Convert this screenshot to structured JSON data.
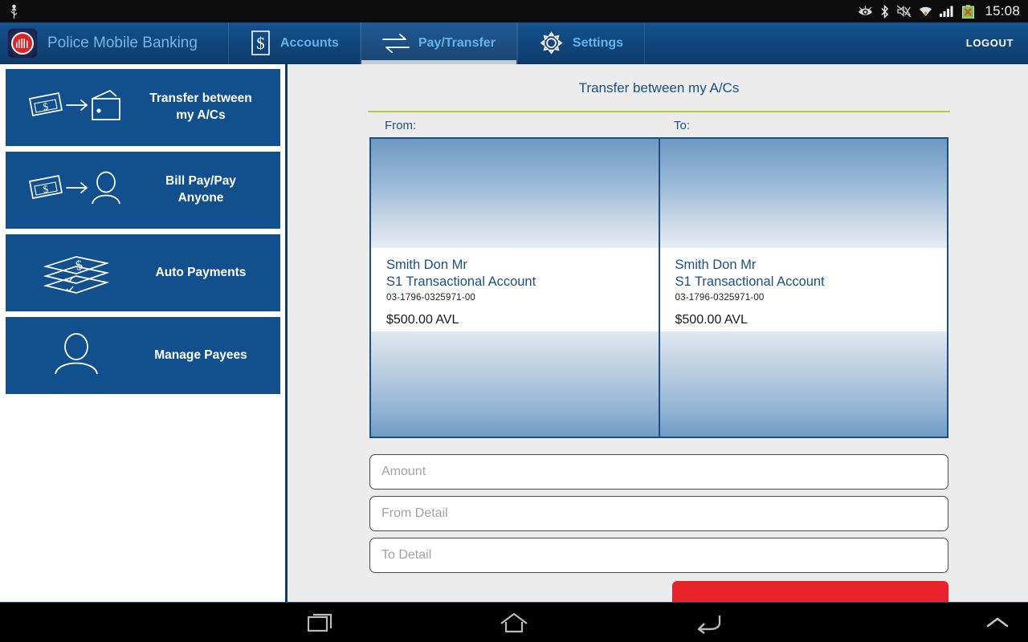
{
  "statusbar": {
    "time": "15:08",
    "icons": [
      "usb-icon",
      "eye-icon",
      "bluetooth-icon",
      "mute-icon",
      "wifi-icon",
      "signal-icon",
      "battery-icon"
    ]
  },
  "header": {
    "app_title": "Police Mobile Banking",
    "logo_name": "police-credit-union-logo",
    "logout_label": "LOGOUT",
    "tabs": [
      {
        "label": "Accounts",
        "icon": "dollar-document-icon",
        "active": false
      },
      {
        "label": "Pay/Transfer",
        "icon": "transfer-arrows-icon",
        "active": true
      },
      {
        "label": "Settings",
        "icon": "gear-icon",
        "active": false
      }
    ]
  },
  "sidebar": {
    "items": [
      {
        "label": "Transfer between\nmy A/Cs",
        "icon": "cash-to-wallet-icon"
      },
      {
        "label": "Bill Pay/Pay\nAnyone",
        "icon": "cash-to-person-icon"
      },
      {
        "label": "Auto Payments",
        "icon": "stacked-cheques-icon"
      },
      {
        "label": "Manage Payees",
        "icon": "person-icon"
      }
    ]
  },
  "main": {
    "title": "Transfer between my A/Cs",
    "from_label": "From:",
    "to_label": "To:",
    "accounts": {
      "from": {
        "name": "Smith Don Mr",
        "type": "S1 Transactional Account",
        "number": "03-1796-0325971-00",
        "balance": "$500.00 AVL"
      },
      "to": {
        "name": "Smith Don Mr",
        "type": "S1 Transactional Account",
        "number": "03-1796-0325971-00",
        "balance": "$500.00 AVL"
      }
    },
    "fields": [
      {
        "name": "amount",
        "placeholder": "Amount",
        "value": ""
      },
      {
        "name": "from-detail",
        "placeholder": "From Detail",
        "value": ""
      },
      {
        "name": "to-detail",
        "placeholder": "To Detail",
        "value": ""
      }
    ],
    "submit_label": ""
  },
  "navbar": {
    "buttons": [
      "recents-icon",
      "home-icon",
      "back-icon",
      "chevron-up-icon"
    ]
  },
  "colors": {
    "header_blue": "#10457a",
    "tile_blue": "#11508d",
    "accent_link": "#64b4ec",
    "divider_olive": "#b5c84a",
    "submit_red": "#e8222a",
    "text_navy": "#1b4f86"
  }
}
